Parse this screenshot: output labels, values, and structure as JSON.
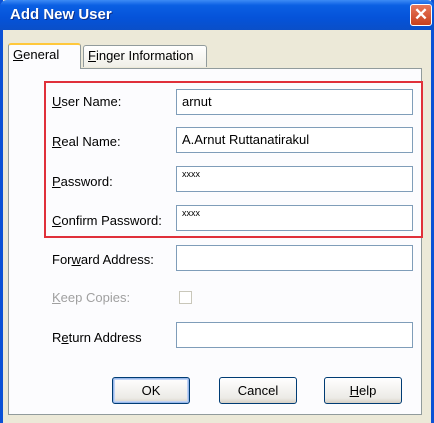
{
  "window": {
    "title": "Add New User",
    "close_glyph": "✕"
  },
  "tabs": [
    {
      "prefix": "",
      "accel": "G",
      "rest": "eneral",
      "active": true
    },
    {
      "prefix": "",
      "accel": "F",
      "rest": "inger Information",
      "active": false
    }
  ],
  "form": {
    "user_name": {
      "label_accel": "U",
      "label_rest": "ser Name:",
      "value": "arnut"
    },
    "real_name": {
      "label_accel": "R",
      "label_rest": "eal Name:",
      "value": "A.Arnut Ruttanatirakul"
    },
    "password": {
      "label_accel": "P",
      "label_rest": "assword:",
      "value": "xxxx"
    },
    "confirm_password": {
      "label_accel": "C",
      "label_rest": "onfirm Password:",
      "value": "xxxx"
    },
    "forward_address": {
      "label_pre": "For",
      "label_accel": "w",
      "label_rest": "ard Address:",
      "value": ""
    },
    "keep_copies": {
      "label_accel": "K",
      "label_rest": "eep Copies:",
      "checked": false
    },
    "return_address": {
      "label_pre": "R",
      "label_accel": "e",
      "label_rest": "turn Address",
      "value": ""
    }
  },
  "buttons": {
    "ok": {
      "label": "OK"
    },
    "cancel": {
      "label": "Cancel"
    },
    "help": {
      "accel": "H",
      "rest": "elp"
    }
  },
  "colors": {
    "title_bar": "#0553d9",
    "highlight": "#e0303a",
    "dialog_bg": "#ece9d8"
  }
}
